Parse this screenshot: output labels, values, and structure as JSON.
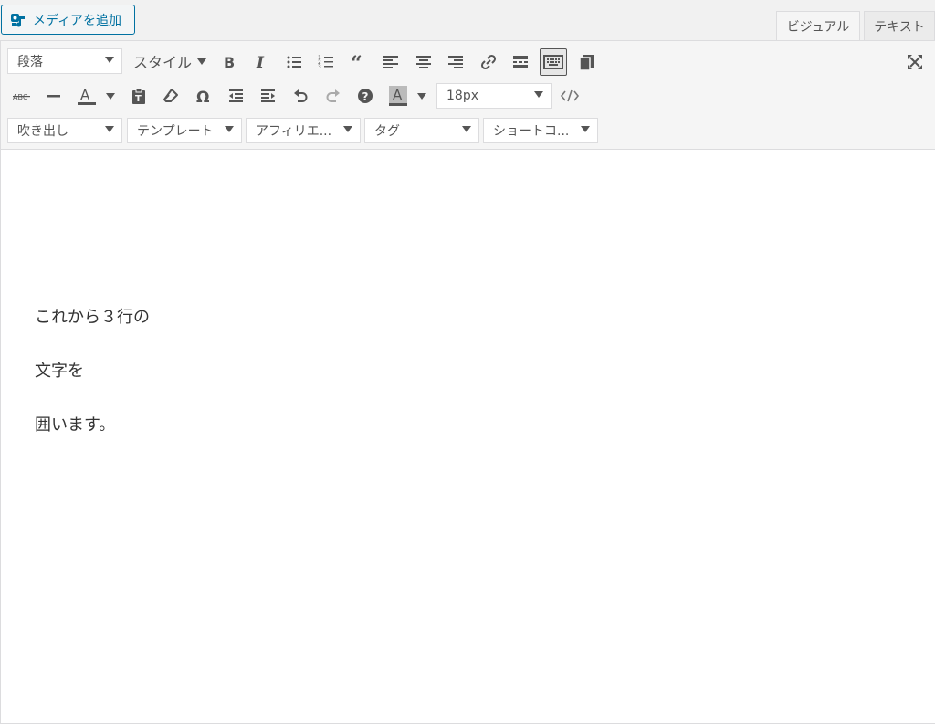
{
  "media_button": {
    "label": "メディアを追加",
    "icon": "media-add-icon"
  },
  "tabs": [
    {
      "label": "ビジュアル",
      "active": true
    },
    {
      "label": "テキスト",
      "active": false
    }
  ],
  "toolbar1": {
    "format_select": "段落",
    "style_select": "スタイル",
    "buttons": [
      "bold-icon",
      "italic-icon",
      "bullet-list-icon",
      "numbered-list-icon",
      "blockquote-icon",
      "align-left-icon",
      "align-center-icon",
      "align-right-icon",
      "link-icon",
      "read-more-icon",
      "toolbar-toggle-icon",
      "copy-icon"
    ],
    "fullscreen": "fullscreen-icon"
  },
  "toolbar2": {
    "buttons": [
      "strikethrough-icon",
      "horizontal-line-icon",
      "text-color-icon",
      "paste-text-icon",
      "clear-format-icon",
      "special-char-icon",
      "outdent-icon",
      "indent-icon",
      "undo-icon",
      "redo-icon",
      "help-icon",
      "bg-color-icon",
      "code-icon"
    ],
    "font_size": "18px",
    "text_color_letter": "A",
    "bg_color_letter": "A"
  },
  "toolbar3": {
    "selects": [
      "吹き出し",
      "テンプレート",
      "アフィリエ...",
      "タグ",
      "ショートコ..."
    ]
  },
  "content": {
    "lines": [
      "これから３行の",
      "文字を",
      "囲います。"
    ]
  },
  "colors": {
    "accent": "#0071a1",
    "icon": "#555555"
  }
}
